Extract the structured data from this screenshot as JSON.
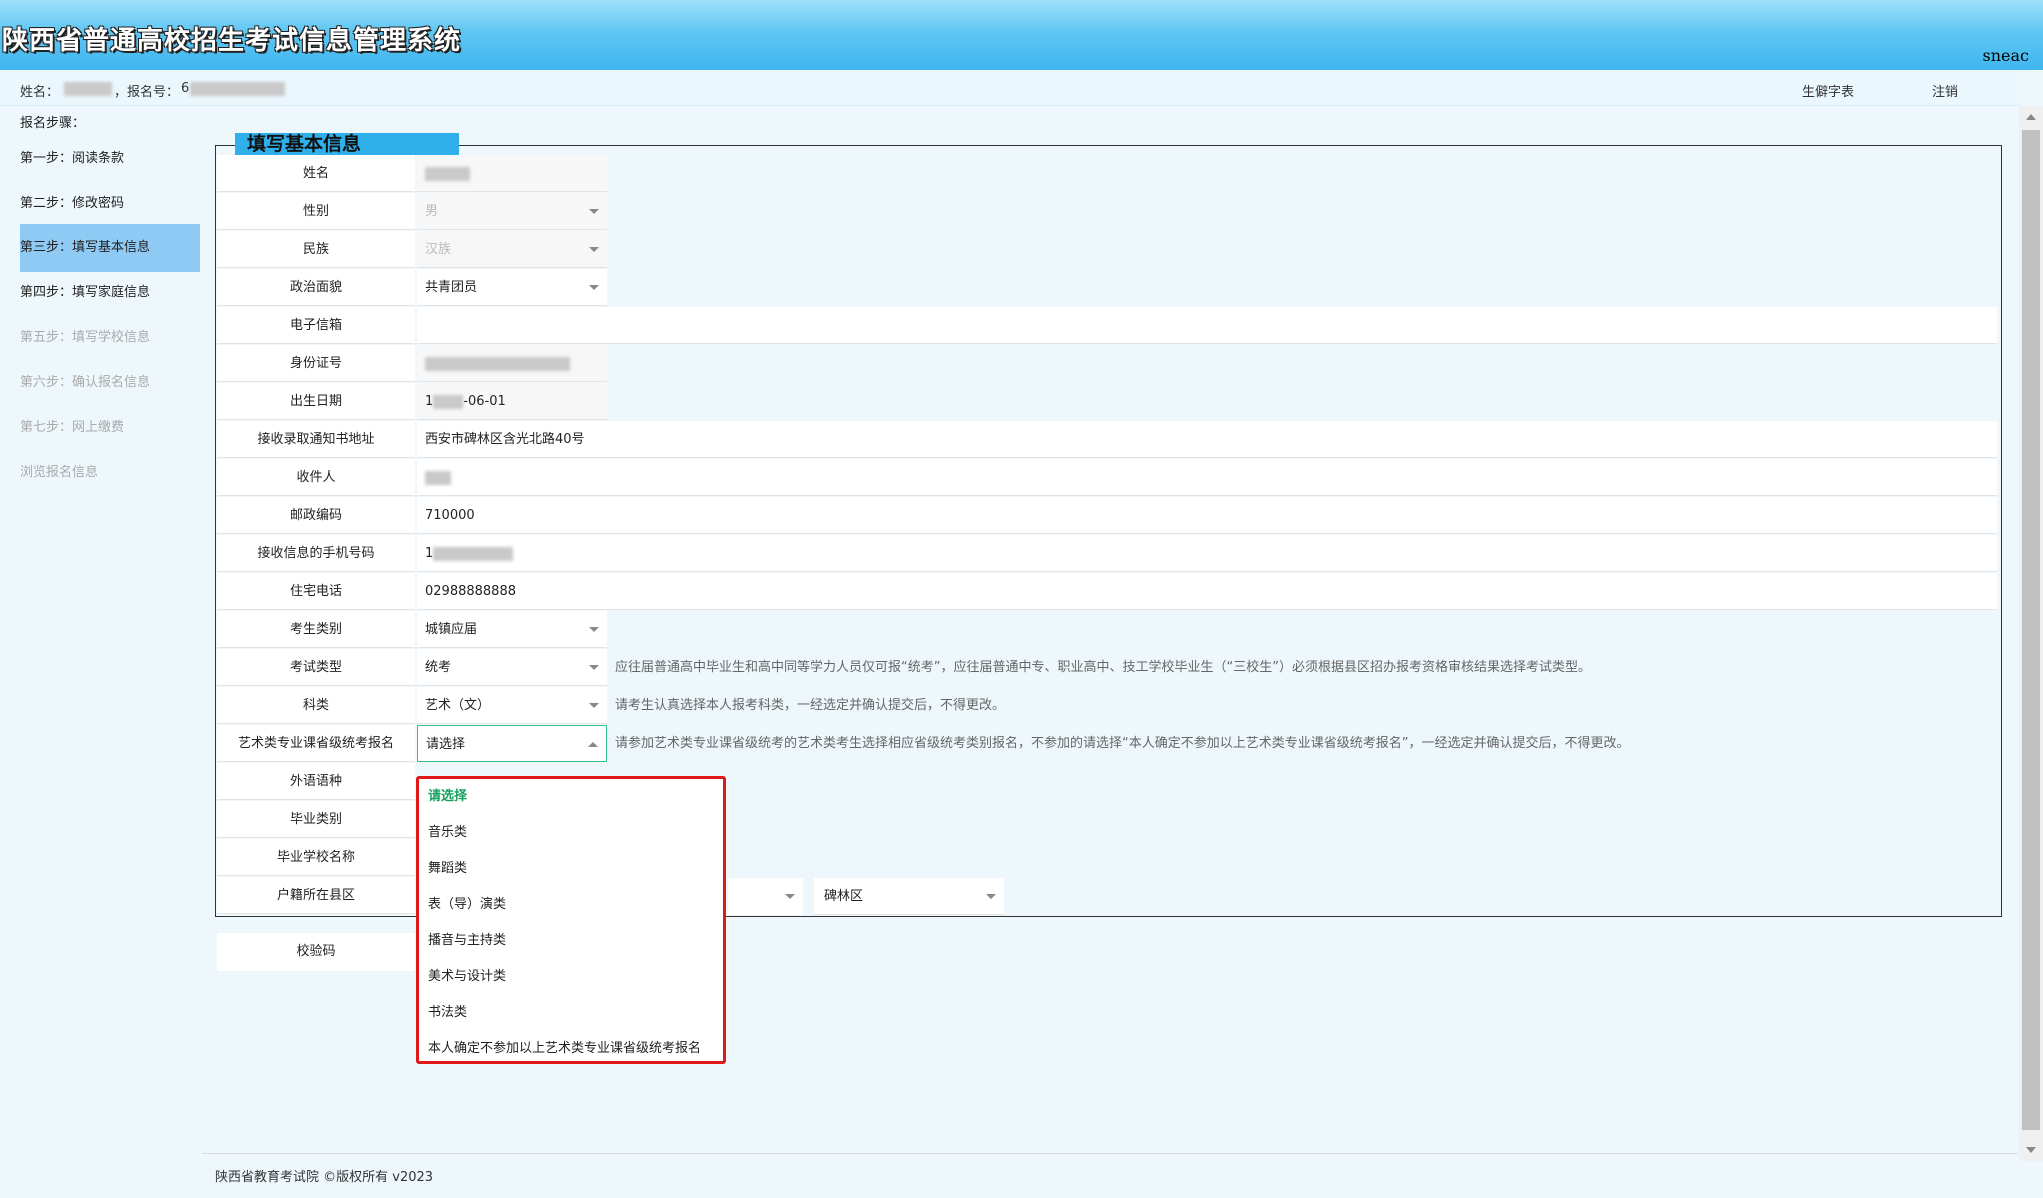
{
  "header": {
    "title": "陕西省普通高校招生考试信息管理系统",
    "brand": "sneac"
  },
  "userbar": {
    "name_label": "姓名：",
    "reg_label": "，报名号：",
    "reg_prefix": "6",
    "links": {
      "form": "生僻字表",
      "logout": "注销"
    }
  },
  "sidebar": {
    "title": "报名步骤：",
    "steps": [
      {
        "label": "第一步：阅读条款"
      },
      {
        "label": "第二步：修改密码"
      },
      {
        "label": "第三步：填写基本信息"
      },
      {
        "label": "第四步：填写家庭信息"
      },
      {
        "label": "第五步：填写学校信息"
      },
      {
        "label": "第六步：确认报名信息"
      },
      {
        "label": "第七步：网上缴费"
      },
      {
        "label": "浏览报名信息"
      }
    ]
  },
  "form": {
    "section_title": "填写基本信息",
    "fields": {
      "name": {
        "label": "姓名",
        "value": ""
      },
      "gender": {
        "label": "性别",
        "value": "男"
      },
      "ethnicity": {
        "label": "民族",
        "value": "汉族"
      },
      "political": {
        "label": "政治面貌",
        "value": "共青团员"
      },
      "email": {
        "label": "电子信箱",
        "value": ""
      },
      "id_number": {
        "label": "身份证号",
        "value": ""
      },
      "birth": {
        "label": "出生日期",
        "value": "-06-01",
        "prefix": "1"
      },
      "address": {
        "label": "接收录取通知书地址",
        "value": "西安市碑林区含光北路40号"
      },
      "recipient": {
        "label": "收件人",
        "value": ""
      },
      "postal": {
        "label": "邮政编码",
        "value": "710000"
      },
      "mobile": {
        "label": "接收信息的手机号码",
        "value": "1"
      },
      "home_phone": {
        "label": "住宅电话",
        "value": "02988888888"
      },
      "student_type": {
        "label": "考生类别",
        "value": "城镇应届"
      },
      "exam_type": {
        "label": "考试类型",
        "value": "统考",
        "hint": "应往届普通高中毕业生和高中同等学力人员仅可报“统考”，应往届普通中专、职业高中、技工学校毕业生（“三校生”）必须根据县区招办报考资格审核结果选择考试类型。"
      },
      "subject": {
        "label": "科类",
        "value": "艺术（文）",
        "hint": "请考生认真选择本人报考科类，一经选定并确认提交后，不得更改。"
      },
      "art_exam": {
        "label": "艺术类专业课省级统考报名",
        "value": "请选择",
        "hint": "请参加艺术类专业课省级统考的艺术类考生选择相应省级统考类别报名，不参加的请选择“本人确定不参加以上艺术类专业课省级统考报名”，一经选定并确认提交后，不得更改。"
      },
      "language": {
        "label": "外语语种"
      },
      "graduation": {
        "label": "毕业类别"
      },
      "school": {
        "label": "毕业学校名称"
      },
      "household": {
        "label": "户籍所在县区",
        "county": "碑林区"
      }
    },
    "verify_label": "校验码"
  },
  "dropdown": {
    "options": [
      "请选择",
      "音乐类",
      "舞蹈类",
      "表（导）演类",
      "播音与主持类",
      "美术与设计类",
      "书法类",
      "本人确定不参加以上艺术类专业课省级统考报名"
    ]
  },
  "footer": {
    "text": "陕西省教育考试院 ©版权所有 v2023"
  },
  "colors": {
    "banner": "#3fb6ee",
    "active_step": "#8fcaf5",
    "dropdown_border": "#e01919",
    "selected_option": "#16a05d"
  }
}
